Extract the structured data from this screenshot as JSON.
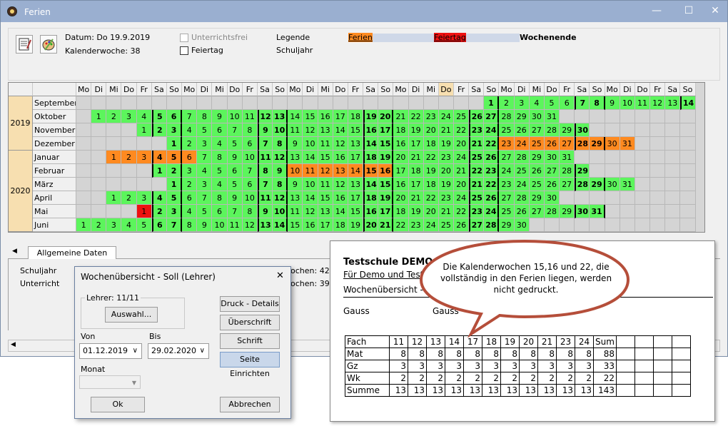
{
  "window": {
    "title": "Ferien",
    "minimize": "—",
    "maximize": "☐",
    "close": "✕"
  },
  "toolbar": {
    "datum": "Datum: Do 19.9.2019",
    "kalenderwoche": "Kalenderwoche: 38",
    "unterrichtsfrei": "Unterrichtsfrei",
    "feiertag": "Feiertag",
    "legende": "Legende",
    "schuljahr": "Schuljahr",
    "leg_ferien": "Ferien",
    "leg_feiertag": "Feiertag",
    "leg_wochenende": "Wochenende"
  },
  "colors": {
    "ferien": "#ff8a20",
    "feiertag": "#ee1111",
    "unterricht": "#5cf55c",
    "wochenende": "#cfd8e8"
  },
  "calendar": {
    "weekdays": [
      "Mo",
      "Di",
      "Mi",
      "Do",
      "Fr",
      "Sa",
      "So",
      "Mo",
      "Di",
      "Mi",
      "Do",
      "Fr",
      "Sa",
      "So",
      "Mo",
      "Di",
      "Mi",
      "Do",
      "Fr",
      "Sa",
      "So",
      "Mo",
      "Di",
      "Mi",
      "Do",
      "Fr",
      "Sa",
      "So",
      "Mo",
      "Di",
      "Mi",
      "Do",
      "Fr",
      "Sa",
      "So",
      "Mo",
      "Di",
      "Do",
      "Fr",
      "Sa",
      "So"
    ],
    "years": [
      "2019",
      "2020"
    ],
    "months": [
      {
        "name": "September",
        "start": 27,
        "days": 30,
        "hol": [],
        "feier": []
      },
      {
        "name": "Oktober",
        "start": 1,
        "days": 31,
        "hol": [],
        "feier": []
      },
      {
        "name": "November",
        "start": 4,
        "days": 30,
        "hol": [],
        "feier": []
      },
      {
        "name": "Dezember",
        "start": 6,
        "days": 31,
        "hol": [
          23,
          24,
          25,
          26,
          27,
          28,
          29,
          30,
          31
        ],
        "feier": []
      },
      {
        "name": "Januar",
        "start": 2,
        "days": 31,
        "hol": [
          1,
          2,
          3,
          4,
          5,
          6
        ],
        "feier": []
      },
      {
        "name": "Februar",
        "start": 5,
        "days": 29,
        "hol": [
          10,
          11,
          12,
          13,
          14,
          15,
          16
        ],
        "feier": []
      },
      {
        "name": "März",
        "start": 6,
        "days": 31,
        "hol": [],
        "feier": []
      },
      {
        "name": "April",
        "start": 2,
        "days": 30,
        "hol": [],
        "feier": []
      },
      {
        "name": "Mai",
        "start": 4,
        "days": 31,
        "hol": [],
        "feier": [
          1
        ]
      },
      {
        "name": "Juni",
        "start": 0,
        "days": 30,
        "hol": [],
        "feier": []
      }
    ]
  },
  "tabs": {
    "active": "Allgemeine Daten",
    "schuljahr": "Schuljahr",
    "unterricht": "Unterricht",
    "wochen1": "ochen: 42",
    "wochen2": "ochen: 39"
  },
  "dialog": {
    "title": "Wochenübersicht - Soll (Lehrer)",
    "lehrer": "Lehrer: 11/11",
    "auswahl": "Auswahl...",
    "von_label": "Von",
    "von": "01.12.2019",
    "bis_label": "Bis",
    "bis": "29.02.2020",
    "monat_label": "Monat",
    "druck": "Druck - Details",
    "ueberschrift": "Überschrift",
    "schrift": "Schrift",
    "seite": "Seite Einrichten",
    "ok": "Ok",
    "abbrechen": "Abbrechen",
    "close": "✕"
  },
  "report": {
    "school": "Testschule DEMO",
    "sub": "Für Demo und Test",
    "title": "Wochenübersicht - S",
    "gauss1": "Gauss",
    "gauss2": "Gauss",
    "header": [
      "Fach",
      "11",
      "12",
      "13",
      "14",
      "17",
      "18",
      "19",
      "20",
      "21",
      "23",
      "24",
      "Sum"
    ],
    "rows": [
      [
        "Mat",
        "8",
        "8",
        "8",
        "8",
        "8",
        "8",
        "8",
        "8",
        "8",
        "8",
        "8",
        "88"
      ],
      [
        "Gz",
        "3",
        "3",
        "3",
        "3",
        "3",
        "3",
        "3",
        "3",
        "3",
        "3",
        "3",
        "33"
      ],
      [
        "Wk",
        "2",
        "2",
        "2",
        "2",
        "2",
        "2",
        "2",
        "2",
        "2",
        "2",
        "2",
        "22"
      ],
      [
        "Summe",
        "13",
        "13",
        "13",
        "13",
        "13",
        "13",
        "13",
        "13",
        "13",
        "13",
        "13",
        "143"
      ]
    ]
  },
  "callout": "Die Kalenderwochen 15,16 und 22, die vollständig in den Ferien liegen, werden nicht gedruckt."
}
